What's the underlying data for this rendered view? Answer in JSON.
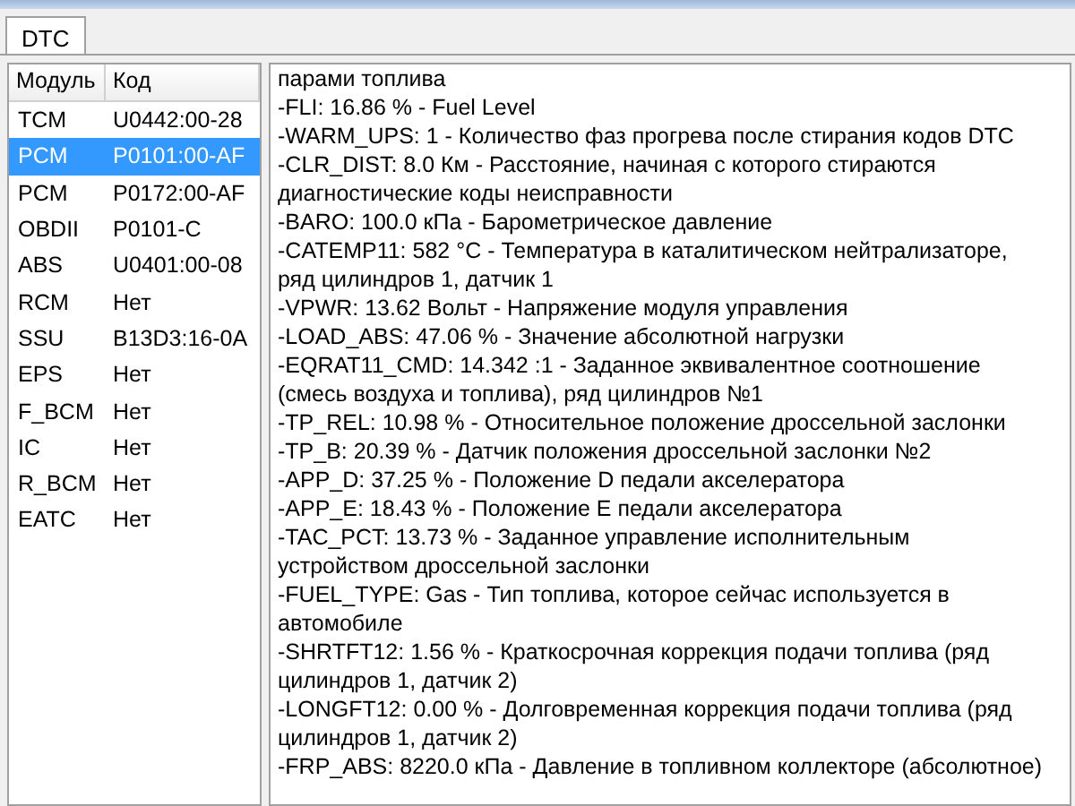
{
  "tabs": [
    {
      "label": "DTC",
      "selected": true
    }
  ],
  "dtc_table": {
    "columns": [
      "Модуль",
      "Код"
    ],
    "rows": [
      {
        "module": "TCM",
        "code": "U0442:00-28",
        "selected": false
      },
      {
        "module": "PCM",
        "code": "P0101:00-AF",
        "selected": true
      },
      {
        "module": "PCM",
        "code": "P0172:00-AF",
        "selected": false
      },
      {
        "module": "OBDII",
        "code": "P0101-C",
        "selected": false
      },
      {
        "module": "ABS",
        "code": "U0401:00-08",
        "selected": false
      },
      {
        "module": "RCM",
        "code": "Нет",
        "selected": false
      },
      {
        "module": "SSU",
        "code": "B13D3:16-0A",
        "selected": false
      },
      {
        "module": "EPS",
        "code": "Нет",
        "selected": false
      },
      {
        "module": "F_BCM",
        "code": "Нет",
        "selected": false
      },
      {
        "module": "IC",
        "code": "Нет",
        "selected": false
      },
      {
        "module": "R_BCM",
        "code": "Нет",
        "selected": false
      },
      {
        "module": "EATC",
        "code": "Нет",
        "selected": false
      }
    ]
  },
  "details": {
    "lines": [
      "парами топлива",
      "-FLI: 16.86 % - Fuel Level",
      "-WARM_UPS: 1   - Количество фаз прогрева после стирания кодов DTC",
      "-CLR_DIST: 8.0 Км - Расстояние, начиная с которого стираются",
      "диагностические коды неисправности",
      "-BARO: 100.0 кПа - Барометрическое давление",
      "-CATEMP11: 582 °C - Температура в каталитическом нейтрализаторе,",
      "ряд цилиндров 1, датчик 1",
      "-VPWR: 13.62 Вольт - Напряжение модуля управления",
      "-LOAD_ABS: 47.06 % - Значение абсолютной нагрузки",
      "-EQRAT11_CMD: 14.342 :1 - Заданное эквивалентное соотношение",
      "(смесь воздуха и топлива), ряд цилиндров №1",
      "-TP_REL: 10.98 % - Относительное положение дроссельной заслонки",
      "-TP_B: 20.39 % - Датчик положения дроссельной заслонки №2",
      "-APP_D: 37.25 % - Положение D педали акселератора",
      "-APP_E: 18.43 % - Положение E педали акселератора",
      "-TAC_PCT: 13.73 % - Заданное управление исполнительным",
      "устройством дроссельной заслонки",
      "-FUEL_TYPE: Gas  - Тип топлива, которое сейчас используется в",
      "автомобиле",
      "-SHRTFT12: 1.56 % - Краткосрочная коррекция подачи топлива (ряд",
      "цилиндров 1, датчик 2)",
      "-LONGFT12: 0.00 % - Долговременная коррекция подачи топлива (ряд",
      "цилиндров 1, датчик 2)",
      "-FRP_ABS: 8220.0 кПа - Давление в топливном коллекторе (абсолютное)"
    ]
  }
}
